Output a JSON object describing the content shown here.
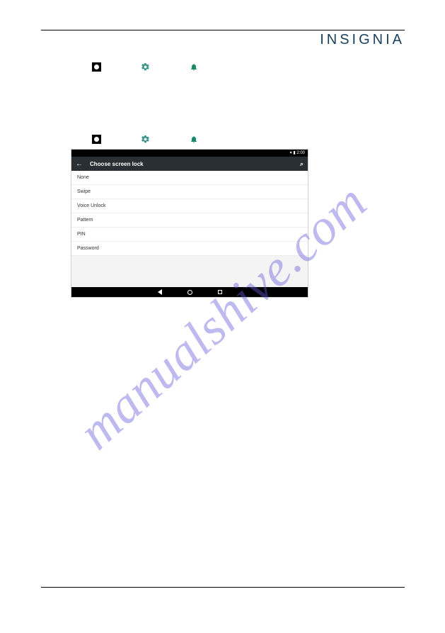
{
  "brand": "INSIGNIA",
  "watermark": "manualshive.com",
  "icons": {
    "app": "app-drawer-icon",
    "gear": "settings-gear-icon",
    "bell": "notification-bell-icon"
  },
  "tablet": {
    "status_time": "2:00",
    "title": "Choose screen lock",
    "options": [
      "None",
      "Swipe",
      "Voice Unlock",
      "Pattern",
      "PIN",
      "Password"
    ]
  }
}
